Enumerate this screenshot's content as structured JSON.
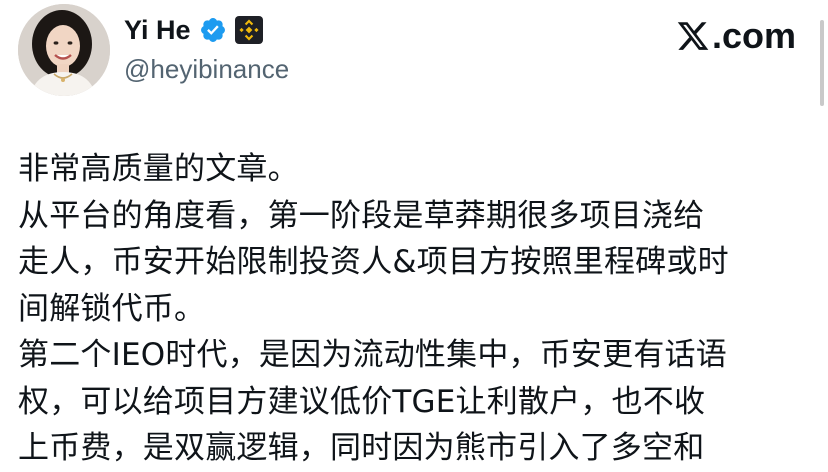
{
  "author": {
    "display_name": "Yi He",
    "handle": "@heyibinance",
    "avatar_icon": "profile-photo",
    "verified_icon": "verified-badge-icon",
    "affiliate_icon": "binance-logo-icon"
  },
  "brand": {
    "label": ".com",
    "logo_icon": "x-logo-icon"
  },
  "tweet": {
    "lines": [
      "非常高质量的文章。",
      "从平台的角度看，第一阶段是草莽期很多项目浇给",
      "走人，币安开始限制投资人&项目方按照里程碑或时",
      "间解锁代币。",
      "第二个IEO时代，是因为流动性集中，币安更有话语",
      "权，可以给项目方建议低价TGE让利散户，也不收",
      "上币费，是双赢逻辑，同时因为熊市引入了多空和"
    ]
  },
  "colors": {
    "text_primary": "#0f1419",
    "text_secondary": "#536471",
    "verified_blue": "#1d9bf0",
    "binance_yellow": "#f0b90b"
  }
}
